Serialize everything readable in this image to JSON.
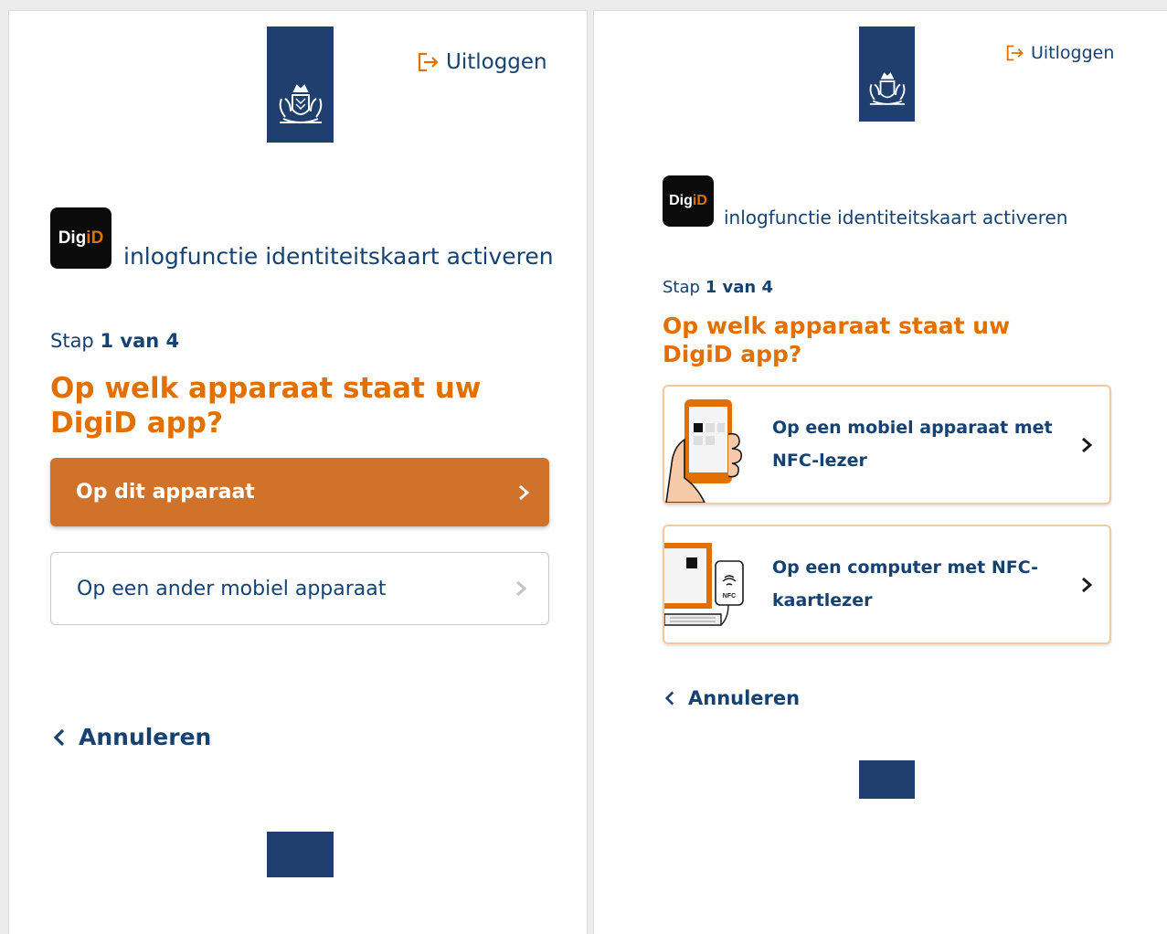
{
  "left": {
    "logout_label": "Uitloggen",
    "badge": {
      "dig": "Dig",
      "d": "iD"
    },
    "subtitle": "inlogfunctie identiteitskaart activeren",
    "step": {
      "prefix": "Stap",
      "current": "1 van 4"
    },
    "question": "Op welk apparaat staat uw DigiD app?",
    "primary_option": "Op dit apparaat",
    "secondary_option": "Op een ander mobiel apparaat",
    "cancel_label": "Annuleren"
  },
  "right": {
    "logout_label": "Uitloggen",
    "badge": {
      "dig": "Dig",
      "d": "iD"
    },
    "subtitle": "inlogfunctie identiteitskaart activeren",
    "step": {
      "prefix": "Stap",
      "current": "1 van 4"
    },
    "question": "Op welk apparaat staat uw DigiD app?",
    "options": [
      {
        "label": "Op een mobiel apparaat met NFC-lezer",
        "icon": "phone-nfc-illustration"
      },
      {
        "label": "Op een computer met NFC-kaartlezer",
        "icon": "computer-nfc-reader-illustration"
      }
    ],
    "reader_text": "NFC",
    "cancel_label": "Annuleren"
  },
  "colors": {
    "brand_blue": "#1f3f6e",
    "accent_orange": "#e17000",
    "button_orange": "#d1722b",
    "text_blue": "#154273"
  }
}
